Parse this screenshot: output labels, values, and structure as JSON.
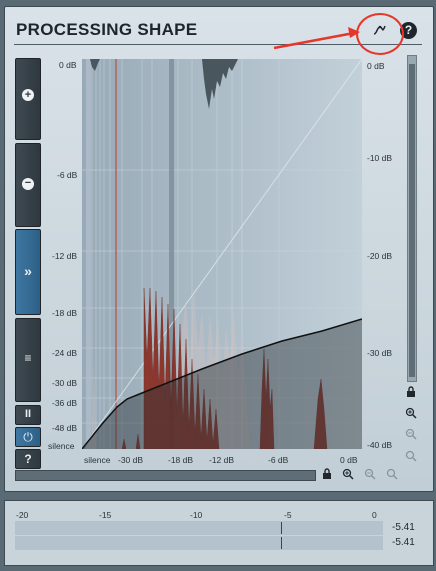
{
  "title": "PROCESSING SHAPE",
  "header_buttons": {
    "shape_icon": "shape-curve-icon",
    "help": "?"
  },
  "left_buttons": {
    "zoom_in": "+",
    "zoom_out": "−",
    "fast_forward": "»",
    "menu": "≡",
    "pause": "II",
    "power": "⏻",
    "help": "?"
  },
  "y_axis_left": [
    "0 dB",
    "-6 dB",
    "-12 dB",
    "-18 dB",
    "-24 dB",
    "-30 dB",
    "-36 dB",
    "-48 dB",
    "silence"
  ],
  "y_axis_right": [
    "0 dB",
    "-10 dB",
    "-20 dB",
    "-30 dB",
    "-40 dB"
  ],
  "x_axis": [
    "silence",
    "-30 dB",
    "-18 dB",
    "-12 dB",
    "-6 dB",
    "0 dB"
  ],
  "meter": {
    "scale": [
      "-20",
      "-15",
      "-10",
      "-5",
      "0"
    ],
    "value_top": "-5.41",
    "value_bottom": "-5.41"
  },
  "colors": {
    "panel": "#cdd7de",
    "plot_bg": "#a9bac6",
    "histogram": "#8a2a1f",
    "curve": "#1a1a1a",
    "annotation": "#e8352a"
  }
}
